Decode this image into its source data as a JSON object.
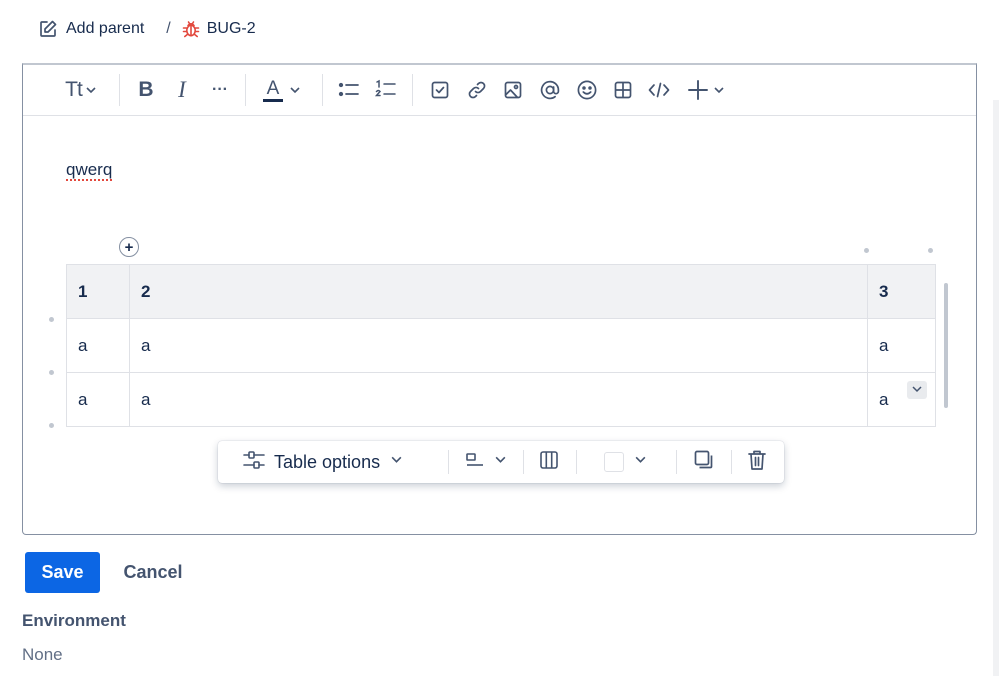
{
  "breadcrumb": {
    "add_parent": "Add parent",
    "separator": "/",
    "issue_key": "BUG-2"
  },
  "toolbar": {
    "text_style": "Tt",
    "bold": "B",
    "italic": "I",
    "more": "···",
    "text_color": "A"
  },
  "editor": {
    "content": "qwerq"
  },
  "table": {
    "header": [
      "1",
      "2",
      "3"
    ],
    "rows": [
      [
        "a",
        "a",
        "a"
      ],
      [
        "a",
        "a",
        "a"
      ]
    ]
  },
  "table_toolbar": {
    "options_label": "Table options"
  },
  "actions": {
    "save": "Save",
    "cancel": "Cancel"
  },
  "environment": {
    "label": "Environment",
    "value": "None"
  },
  "colors": {
    "primary": "#0c66e4",
    "bug_icon": "#e2483d",
    "text": "#172b4d",
    "subtle": "#44546f"
  }
}
